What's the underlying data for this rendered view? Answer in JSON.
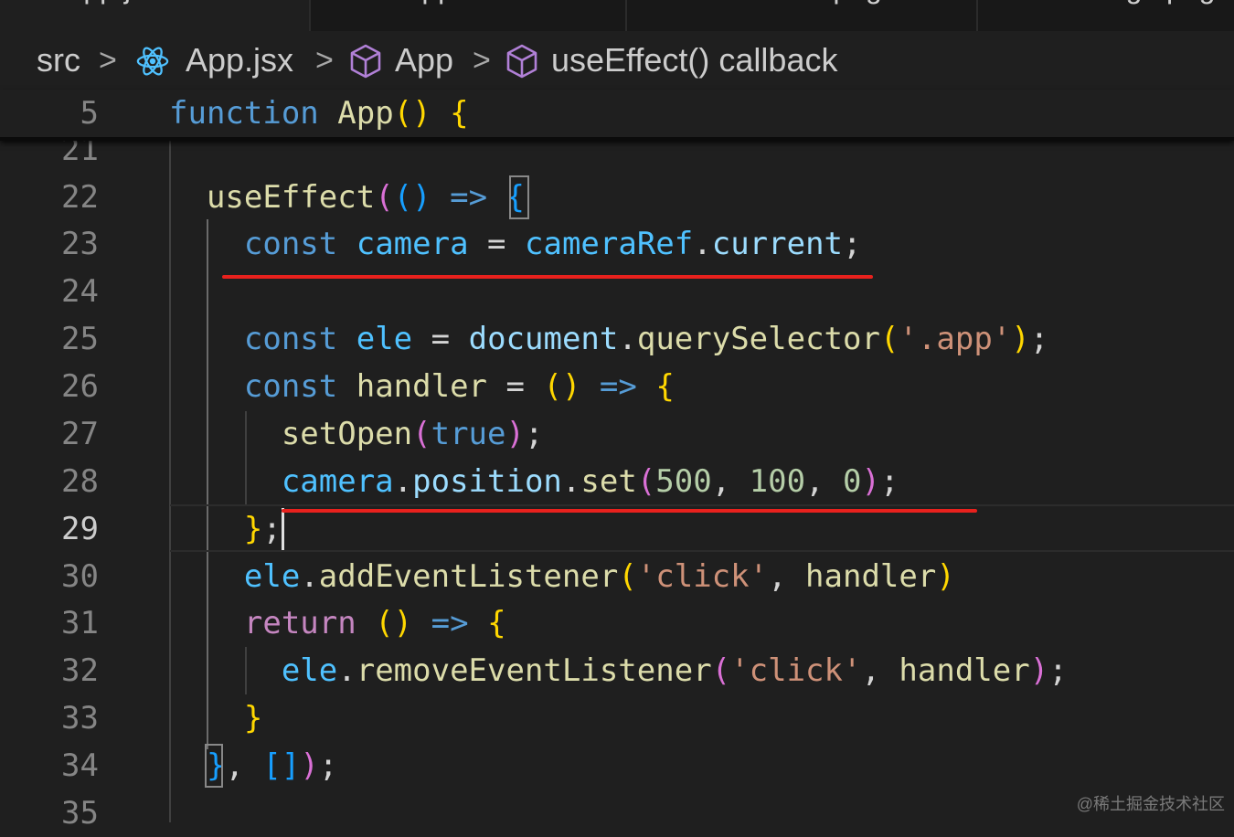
{
  "tabs": [
    {
      "label": "App.jsx",
      "active": true
    },
    {
      "label": "App.css",
      "active": false
    },
    {
      "label": "screenshot.png",
      "active": false
    },
    {
      "label": "image.png",
      "active": false
    }
  ],
  "breadcrumb": {
    "items": [
      {
        "label": "src",
        "icon": ""
      },
      {
        "label": "App.jsx",
        "icon": "react-icon"
      },
      {
        "label": "App",
        "icon": "cube-icon"
      },
      {
        "label": "useEffect() callback",
        "icon": "cube-icon"
      }
    ],
    "separator": ">"
  },
  "sticky": {
    "line": "5"
  },
  "line_numbers": [
    "21",
    "22",
    "23",
    "24",
    "25",
    "26",
    "27",
    "28",
    "29",
    "30",
    "31",
    "32",
    "33",
    "34",
    "35"
  ],
  "current_line": "29",
  "watermark": "@稀土掘金技术社区",
  "colors": {
    "background": "#1f1f1f",
    "keyword": "#569cd6",
    "control": "#c586c0",
    "variable": "#9cdcfe",
    "function": "#dcdcaa",
    "string": "#ce9178",
    "number": "#b5cea8",
    "underline": "#e8211d"
  }
}
